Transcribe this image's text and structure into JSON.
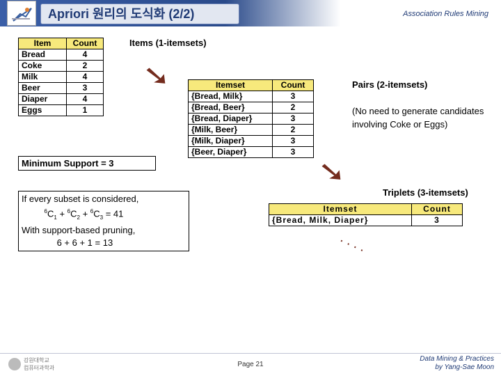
{
  "header": {
    "title": "Apriori 원리의 도식화 (2/2)",
    "subtitle": "Association Rules Mining"
  },
  "items": {
    "caption": "Items (1-itemsets)",
    "cols": [
      "Item",
      "Count"
    ],
    "rows": [
      [
        "Bread",
        "4"
      ],
      [
        "Coke",
        "2"
      ],
      [
        "Milk",
        "4"
      ],
      [
        "Beer",
        "3"
      ],
      [
        "Diaper",
        "4"
      ],
      [
        "Eggs",
        "1"
      ]
    ]
  },
  "pairs": {
    "caption": "Pairs (2-itemsets)",
    "note": "(No need to generate candidates involving Coke or Eggs)",
    "cols": [
      "Itemset",
      "Count"
    ],
    "rows": [
      [
        "{Bread, Milk}",
        "3"
      ],
      [
        "{Bread, Beer}",
        "2"
      ],
      [
        "{Bread, Diaper}",
        "3"
      ],
      [
        "{Milk, Beer}",
        "2"
      ],
      [
        "{Milk, Diaper}",
        "3"
      ],
      [
        "{Beer, Diaper}",
        "3"
      ]
    ]
  },
  "triplets": {
    "caption": "Triplets (3-itemsets)",
    "cols": [
      "Itemset",
      "Count"
    ],
    "rows": [
      [
        "{Bread, Milk, Diaper}",
        "3"
      ]
    ]
  },
  "minsupport": "Minimum Support = 3",
  "combos": {
    "line1": "If every subset is considered,",
    "line2_a": "6",
    "line2_b": "C",
    "line2_s1": "1",
    "line2_c": " + ",
    "line2_d": "6",
    "line2_e": "C",
    "line2_s2": "2",
    "line2_f": " + ",
    "line2_g": "6",
    "line2_h": "C",
    "line2_s3": "3",
    "line2_i": " = 41",
    "line3": "With support-based pruning,",
    "line4": "6 + 6 + 1 = 13"
  },
  "footer": {
    "logo_text": "강원대학교\n컴퓨터과학과",
    "page": "Page 21",
    "credit1": "Data Mining & Practices",
    "credit2": "by Yang-Sae Moon"
  },
  "chart_data": {
    "type": "table",
    "title": "Apriori candidate itemset counts",
    "minimum_support": 3,
    "one_itemsets": {
      "Bread": 4,
      "Coke": 2,
      "Milk": 4,
      "Beer": 3,
      "Diaper": 4,
      "Eggs": 1
    },
    "two_itemsets": {
      "{Bread,Milk}": 3,
      "{Bread,Beer}": 2,
      "{Bread,Diaper}": 3,
      "{Milk,Beer}": 2,
      "{Milk,Diaper}": 3,
      "{Beer,Diaper}": 3
    },
    "three_itemsets": {
      "{Bread,Milk,Diaper}": 3
    },
    "naive_candidate_count": 41,
    "pruned_candidate_count": 13
  }
}
